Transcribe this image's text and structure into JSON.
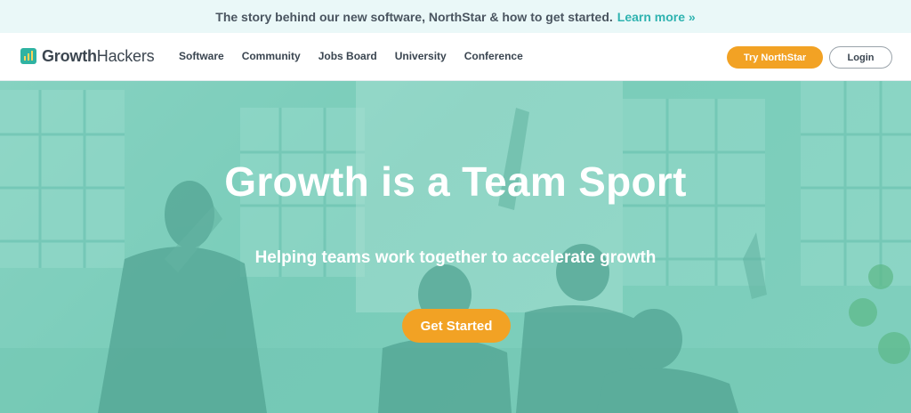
{
  "announcement": {
    "text": "The story behind our new software, NorthStar & how to get started.",
    "link": "Learn more »"
  },
  "logo": {
    "part1": "Growth",
    "part2": "Hackers"
  },
  "nav": {
    "items": [
      "Software",
      "Community",
      "Jobs Board",
      "University",
      "Conference"
    ],
    "try_label": "Try NorthStar",
    "login_label": "Login"
  },
  "hero": {
    "title": "Growth is a Team Sport",
    "subtitle": "Helping teams work together to accelerate growth",
    "cta_label": "Get Started"
  },
  "colors": {
    "accent": "#f2a224",
    "brand_teal": "#2fb3b0",
    "hero_overlay": "#7ccdbb"
  }
}
